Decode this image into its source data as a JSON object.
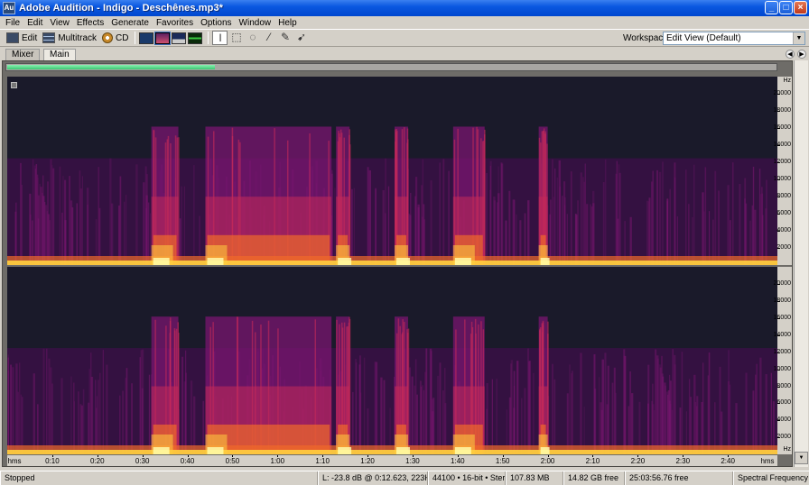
{
  "window": {
    "title": "Adobe Audition - Indigo - Deschênes.mp3*",
    "icon_label": "Au",
    "controls": [
      "minimize-icon",
      "maximize-icon",
      "close-icon"
    ]
  },
  "menu": [
    "File",
    "Edit",
    "View",
    "Effects",
    "Generate",
    "Favorites",
    "Options",
    "Window",
    "Help"
  ],
  "toolbar": {
    "edit_label": "Edit",
    "multitrack_label": "Multitrack",
    "cd_label": "CD",
    "workspace_label": "Workspace:",
    "workspace_value": "Edit View (Default)"
  },
  "tabs": {
    "mixer": "Mixer",
    "main": "Main"
  },
  "overview": {
    "visible_fraction": 0.27,
    "color": "#3bc873"
  },
  "frequency_axis": {
    "unit": "Hz",
    "ticks": [
      "20000",
      "18000",
      "16000",
      "14000",
      "12000",
      "10000",
      "8000",
      "6000",
      "4000",
      "2000"
    ]
  },
  "time_axis": {
    "start": "hms",
    "end": "hms",
    "ticks": [
      "0:10",
      "0:20",
      "0:30",
      "0:40",
      "0:50",
      "1:00",
      "1:10",
      "1:20",
      "1:30",
      "1:40",
      "1:50",
      "2:00",
      "2:10",
      "2:20",
      "2:30",
      "2:40"
    ]
  },
  "spectral": {
    "bursts_seconds": [
      [
        32,
        38
      ],
      [
        44,
        72
      ],
      [
        73,
        76
      ],
      [
        86,
        89
      ],
      [
        99,
        106
      ],
      [
        118,
        120
      ]
    ],
    "palette": [
      "#1a1a2a",
      "#3a1045",
      "#7a1670",
      "#c52a5a",
      "#f06a2a",
      "#ffd040",
      "#ffffb0"
    ]
  },
  "status": {
    "state": "Stopped",
    "cursor": "L: -23.8 dB @  0:12.623, 223Hz",
    "format": "44100 • 16-bit • Stereo",
    "size": "107.83 MB",
    "free_space": "14.82 GB free",
    "free_time": "25:03:56.76 free",
    "view_mode": "Spectral Frequency"
  }
}
